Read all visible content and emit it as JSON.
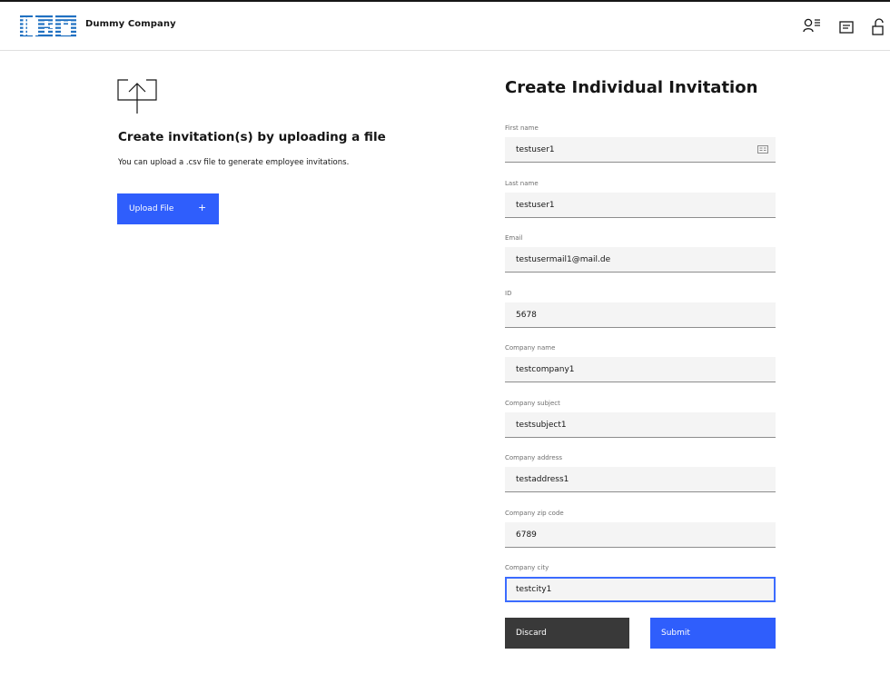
{
  "header": {
    "logo_text": "IBM",
    "company_name": "Dummy Company",
    "icons": [
      "user-list-icon",
      "document-icon",
      "unlock-icon"
    ]
  },
  "upload": {
    "icon": "upload-icon",
    "title": "Create invitation(s) by uploading a file",
    "description": "You can upload a .csv file to generate employee invitations.",
    "button_label": "Upload File",
    "button_icon": "+"
  },
  "form": {
    "title": "Create Individual Invitation",
    "fields": [
      {
        "label": "First name",
        "value": "testuser1"
      },
      {
        "label": "Last name",
        "value": "testuser1"
      },
      {
        "label": "Email",
        "value": "testusermail1@mail.de"
      },
      {
        "label": "ID",
        "value": "5678"
      },
      {
        "label": "Company name",
        "value": "testcompany1"
      },
      {
        "label": "Company subject",
        "value": "testsubject1"
      },
      {
        "label": "Company address",
        "value": "testaddress1"
      },
      {
        "label": "Company zip code",
        "value": "6789"
      },
      {
        "label": "Company city",
        "value": "testcity1"
      }
    ],
    "discard_label": "Discard",
    "submit_label": "Submit"
  },
  "colors": {
    "primary": "#2f5efc",
    "secondary": "#393939",
    "field_bg": "#f4f4f4",
    "focus": "#3c6cff"
  }
}
